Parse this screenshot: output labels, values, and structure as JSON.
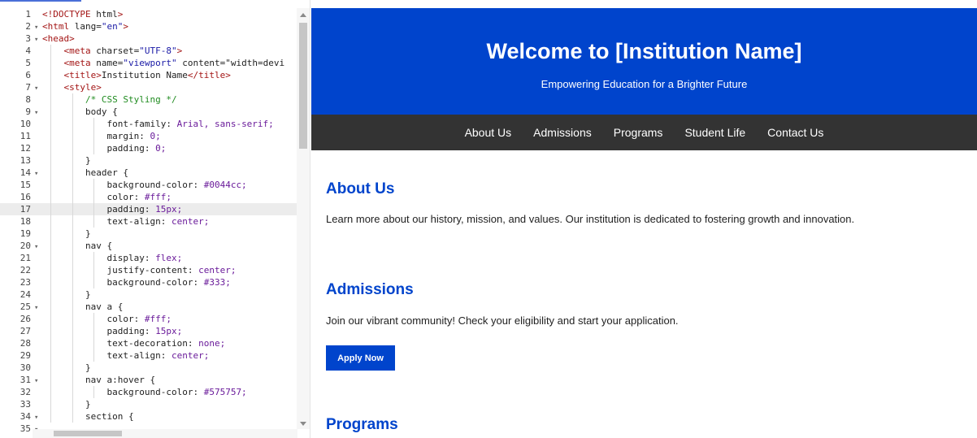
{
  "editor": {
    "lines": [
      {
        "n": "1",
        "fold": false,
        "text": "<!DOCTYPE html>"
      },
      {
        "n": "2",
        "fold": true,
        "text": "<html lang=\"en\">"
      },
      {
        "n": "3",
        "fold": true,
        "text": "<head>"
      },
      {
        "n": "4",
        "fold": false,
        "text": "    <meta charset=\"UTF-8\">"
      },
      {
        "n": "5",
        "fold": false,
        "text": "    <meta name=\"viewport\" content=\"width=devi"
      },
      {
        "n": "6",
        "fold": false,
        "text": "    <title>Institution Name</title>"
      },
      {
        "n": "7",
        "fold": true,
        "text": "    <style>"
      },
      {
        "n": "8",
        "fold": false,
        "text": "        /* CSS Styling */"
      },
      {
        "n": "9",
        "fold": true,
        "text": "        body {"
      },
      {
        "n": "10",
        "fold": false,
        "text": "            font-family: Arial, sans-serif;"
      },
      {
        "n": "11",
        "fold": false,
        "text": "            margin: 0;"
      },
      {
        "n": "12",
        "fold": false,
        "text": "            padding: 0;"
      },
      {
        "n": "13",
        "fold": false,
        "text": "        }"
      },
      {
        "n": "14",
        "fold": true,
        "text": "        header {"
      },
      {
        "n": "15",
        "fold": false,
        "text": "            background-color: #0044cc;"
      },
      {
        "n": "16",
        "fold": false,
        "text": "            color: #fff;"
      },
      {
        "n": "17",
        "fold": false,
        "text": "            padding: 15px;"
      },
      {
        "n": "18",
        "fold": false,
        "text": "            text-align: center;"
      },
      {
        "n": "19",
        "fold": false,
        "text": "        }"
      },
      {
        "n": "20",
        "fold": true,
        "text": "        nav {"
      },
      {
        "n": "21",
        "fold": false,
        "text": "            display: flex;"
      },
      {
        "n": "22",
        "fold": false,
        "text": "            justify-content: center;"
      },
      {
        "n": "23",
        "fold": false,
        "text": "            background-color: #333;"
      },
      {
        "n": "24",
        "fold": false,
        "text": "        }"
      },
      {
        "n": "25",
        "fold": true,
        "text": "        nav a {"
      },
      {
        "n": "26",
        "fold": false,
        "text": "            color: #fff;"
      },
      {
        "n": "27",
        "fold": false,
        "text": "            padding: 15px;"
      },
      {
        "n": "28",
        "fold": false,
        "text": "            text-decoration: none;"
      },
      {
        "n": "29",
        "fold": false,
        "text": "            text-align: center;"
      },
      {
        "n": "30",
        "fold": false,
        "text": "        }"
      },
      {
        "n": "31",
        "fold": true,
        "text": "        nav a:hover {"
      },
      {
        "n": "32",
        "fold": false,
        "text": "            background-color: #575757;"
      },
      {
        "n": "33",
        "fold": false,
        "text": "        }"
      },
      {
        "n": "34",
        "fold": true,
        "text": "        section {"
      },
      {
        "n": "35",
        "fold": true,
        "text": ""
      }
    ],
    "active_line": "17"
  },
  "preview": {
    "header": {
      "title": "Welcome to [Institution Name]",
      "tagline": "Empowering Education for a Brighter Future",
      "bg_color": "#0044cc"
    },
    "nav": {
      "bg_color": "#333333",
      "links": [
        "About Us",
        "Admissions",
        "Programs",
        "Student Life",
        "Contact Us"
      ]
    },
    "sections": {
      "about": {
        "title": "About Us",
        "text": "Learn more about our history, mission, and values. Our institution is dedicated to fostering growth and innovation."
      },
      "admissions": {
        "title": "Admissions",
        "text": "Join our vibrant community! Check your eligibility and start your application.",
        "button_label": "Apply Now"
      },
      "programs": {
        "title": "Programs"
      }
    }
  }
}
